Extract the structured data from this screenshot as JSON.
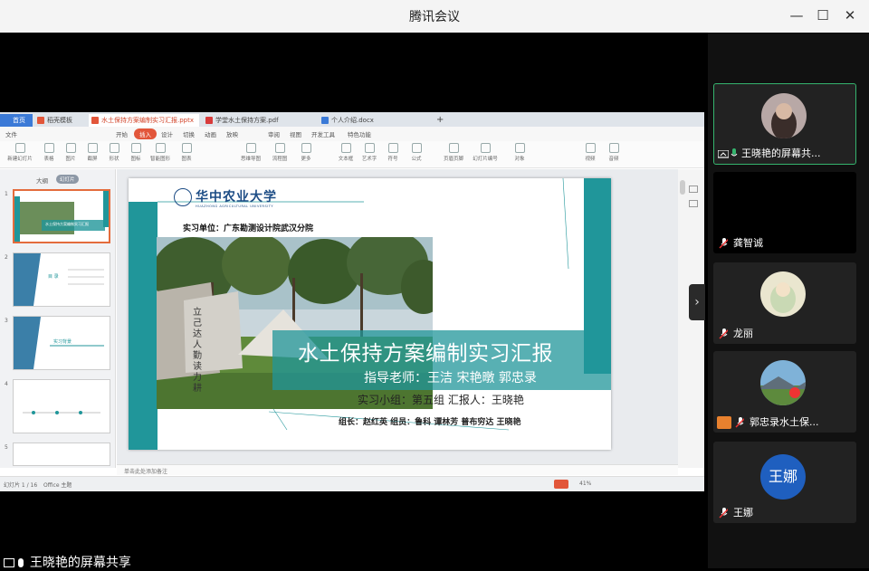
{
  "app": {
    "title": "腾讯会议"
  },
  "window_controls": {
    "minimize": "—",
    "maximize": "☐",
    "close": "✕"
  },
  "wps": {
    "tabs": [
      {
        "label": "首页"
      },
      {
        "label": "稻壳模板"
      },
      {
        "label": "水土保持方案编制实习汇报.pptx"
      },
      {
        "label": "学堂水土保持方案.pdf"
      },
      {
        "label": "个人介绍.docx"
      }
    ],
    "add_tab": "+",
    "menu": [
      "文件",
      "开始",
      "插入",
      "设计",
      "切换",
      "动画",
      "放映",
      "审阅",
      "视图",
      "开发工具",
      "特色功能"
    ],
    "menu_active": "插入",
    "ribbon": [
      "新建幻灯片",
      "表格",
      "图片",
      "截屏",
      "形状",
      "图标",
      "智能图形",
      "图表",
      "思维导图",
      "流程图",
      "更多",
      "文本框",
      "艺术字",
      "符号",
      "公式",
      "页眉页脚",
      "幻灯片编号",
      "对象",
      "视频",
      "音频"
    ],
    "left_panel": {
      "header": "大纲",
      "badge": "幻灯片",
      "slide_numbers": [
        "1",
        "2",
        "3",
        "4",
        "5"
      ]
    },
    "notes_placeholder": "单击此处添加备注",
    "status": {
      "slide_counter": "幻灯片 1 / 16",
      "theme": "Office 主题",
      "zoom": "41%"
    },
    "slide_thumbs": {
      "thumb1_title": "水土保持方案编制实习汇报",
      "thumb2_title": "目 录",
      "thumb3_title": "实习背景"
    }
  },
  "slide": {
    "university": "华中农业大学",
    "university_en": "HUAZHONG AGRICULTURAL UNIVERSITY",
    "unit": "实习单位：广东勘测设计院武汉分院",
    "title": "水土保持方案编制实习汇报",
    "teacher": "指导老师：王洁 宋艳暾 郭忠录",
    "group": "实习小组：第五组      汇报人：王晓艳",
    "members": "组长：赵红英      组员：鲁科  谭林芳  普布穷达  王晓艳",
    "stone_text": "立 己 达 人   勤 读 力 耕"
  },
  "participants": [
    {
      "name": "王晓艳的屏幕共...",
      "kind": "photo",
      "active": true
    },
    {
      "name": "龚智诚",
      "kind": "blank",
      "active": false
    },
    {
      "name": "龙丽",
      "kind": "illustration",
      "active": false
    },
    {
      "name": "郭忠录水土保...",
      "kind": "landscape",
      "active": false
    },
    {
      "name": "王娜",
      "kind": "initials",
      "initials": "王娜",
      "active": false
    }
  ],
  "share_label": "王晓艳的屏幕共享",
  "colors": {
    "teal": "#20969a",
    "wps_accent": "#e2563a",
    "active_green": "#35b46e"
  }
}
